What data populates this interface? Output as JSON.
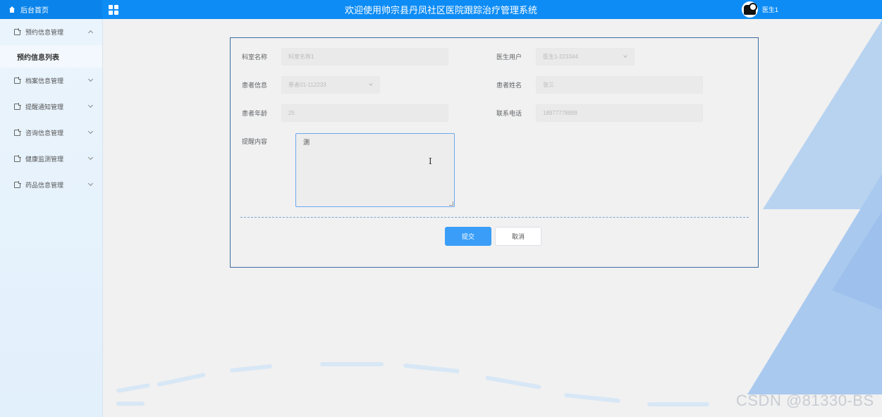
{
  "header": {
    "home_label": "后台首页",
    "system_title": "欢迎使用帅宗县丹凤社区医院跟踪治疗管理系统",
    "user_name": "医生1"
  },
  "sidebar": {
    "items": [
      {
        "label": "预约信息管理",
        "expanded": true
      },
      {
        "label": "档案信息管理"
      },
      {
        "label": "提醒通知管理"
      },
      {
        "label": "咨询信息管理"
      },
      {
        "label": "健康监测管理"
      },
      {
        "label": "药品信息管理"
      }
    ],
    "active_sub_item": "预约信息列表"
  },
  "form": {
    "dept_label": "科室名称",
    "dept_value": "科室名称1",
    "doctor_label": "医生用户",
    "doctor_value": "医生1-223344",
    "patient_info_label": "患者信息",
    "patient_info_value": "患者01-112233",
    "patient_name_label": "患者姓名",
    "patient_name_value": "张三",
    "age_label": "患者年龄",
    "age_value": "25",
    "phone_label": "联系电话",
    "phone_value": "18977778899",
    "reminder_label": "提醒内容",
    "reminder_value": "测",
    "submit_label": "提交",
    "cancel_label": "取消"
  },
  "watermark": "CSDN @81330-BS"
}
